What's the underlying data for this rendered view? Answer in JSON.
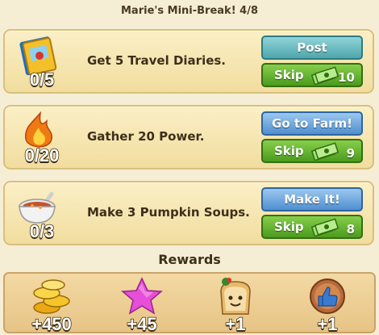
{
  "title": "Marie's Mini-Break! 4/8",
  "quests": [
    {
      "task": "Get 5 Travel Diaries.",
      "progress": "0/5",
      "action_label": "Post",
      "skip_label": "Skip",
      "skip_cost": "10",
      "icon": "travel-diary-icon"
    },
    {
      "task": "Gather 20 Power.",
      "progress": "0/20",
      "action_label": "Go to Farm!",
      "skip_label": "Skip",
      "skip_cost": "9",
      "icon": "power-flame-icon"
    },
    {
      "task": "Make 3 Pumpkin Soups.",
      "progress": "0/3",
      "action_label": "Make It!",
      "skip_label": "Skip",
      "skip_cost": "8",
      "icon": "pumpkin-soup-icon"
    }
  ],
  "rewards_title": "Rewards",
  "rewards": [
    {
      "icon": "coins-icon",
      "amount": "+450"
    },
    {
      "icon": "xp-star-icon",
      "amount": "+45"
    },
    {
      "icon": "toast-character-icon",
      "amount": "+1"
    },
    {
      "icon": "thumbs-up-medal-icon",
      "amount": "+1"
    }
  ],
  "colors": {
    "panel": "#f1dd9e",
    "skip_green": "#4c9b1e",
    "post_teal": "#4fa6ad",
    "action_blue": "#4f8fd0"
  }
}
